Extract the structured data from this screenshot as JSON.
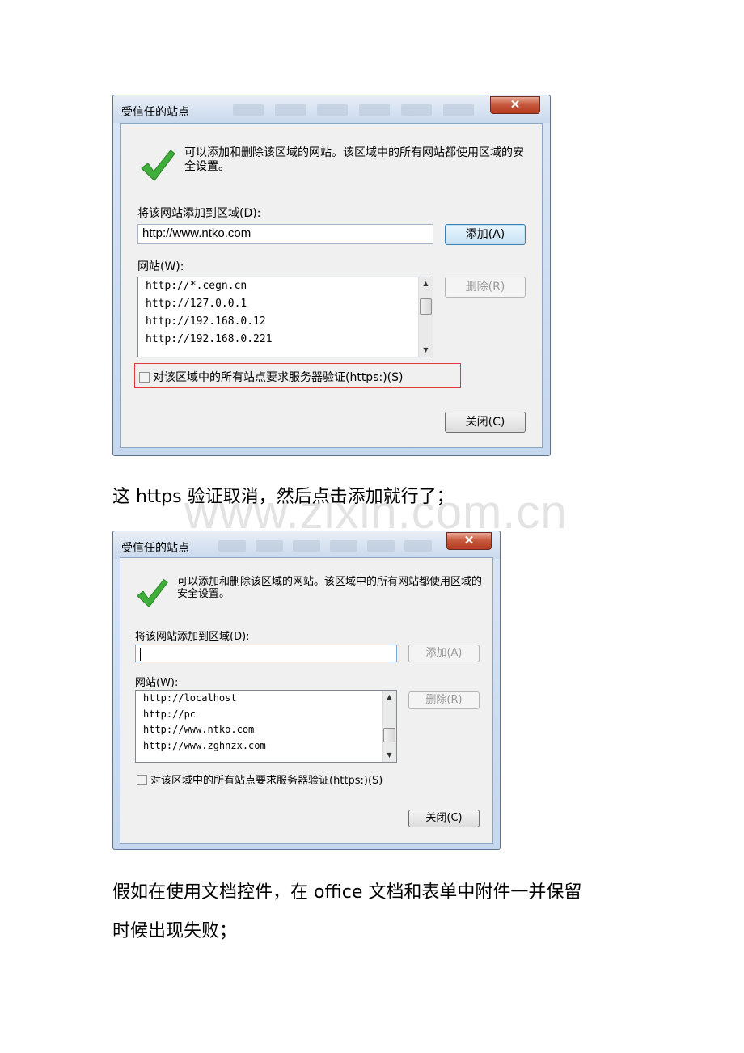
{
  "watermark": "www.zixin.com.cn",
  "dialog1": {
    "title": "受信任的站点",
    "close_glyph": "✕",
    "check_icon": "checkmark-icon",
    "message": "可以添加和删除该区域的网站。该区域中的所有网站都使用区域的安全设置。",
    "add_label": "将该网站添加到区域(D):",
    "url_value": "http://www.ntko.com",
    "add_button": "添加(A)",
    "sites_label": "网站(W):",
    "sites": [
      "http://*.cegn.cn",
      "http://127.0.0.1",
      "http://192.168.0.12",
      "http://192.168.0.221"
    ],
    "remove_button": "删除(R)",
    "https_checkbox": "对该区域中的所有站点要求服务器验证(https:)(S)",
    "close_button": "关闭(C)",
    "highlight_color": "#e0393c"
  },
  "text1": "这 https 验证取消，然后点击添加就行了；",
  "dialog2": {
    "title": "受信任的站点",
    "close_glyph": "✕",
    "message": "可以添加和删除该区域的网站。该区域中的所有网站都使用区域的安全设置。",
    "add_label": "将该网站添加到区域(D):",
    "url_value": "",
    "add_button": "添加(A)",
    "sites_label": "网站(W):",
    "sites": [
      "http://localhost",
      "http://pc",
      "http://www.ntko.com",
      "http://www.zghnzx.com"
    ],
    "remove_button": "删除(R)",
    "https_checkbox": "对该区域中的所有站点要求服务器验证(https:)(S)",
    "close_button": "关闭(C)"
  },
  "text2": "假如在使用文档控件，在 office 文档和表单中附件一并保留",
  "text3": "时候出现失败；"
}
